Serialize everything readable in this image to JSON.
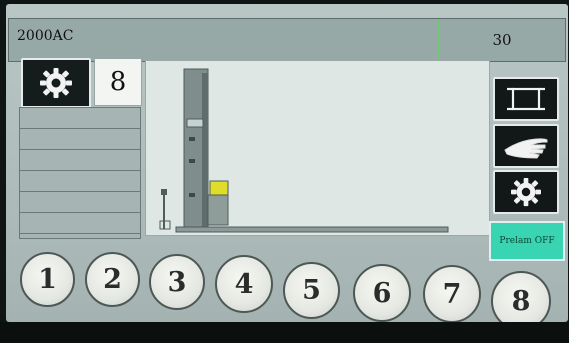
{
  "header": {
    "title": "2000AC",
    "counter": "30"
  },
  "program": {
    "number": "8"
  },
  "list_rows": 6,
  "side_buttons": [
    {
      "icon": "frame-icon"
    },
    {
      "icon": "hand-icon"
    },
    {
      "icon": "gear-icon"
    }
  ],
  "prelam": {
    "label": "Prelam OFF",
    "color": "#39d5b2"
  },
  "steps": [
    "1",
    "2",
    "3",
    "4",
    "5",
    "6",
    "7",
    "8"
  ],
  "colors": {
    "bezel": "#0e1512",
    "panel": "#aebcbc",
    "accent_green": "#6fc872"
  }
}
